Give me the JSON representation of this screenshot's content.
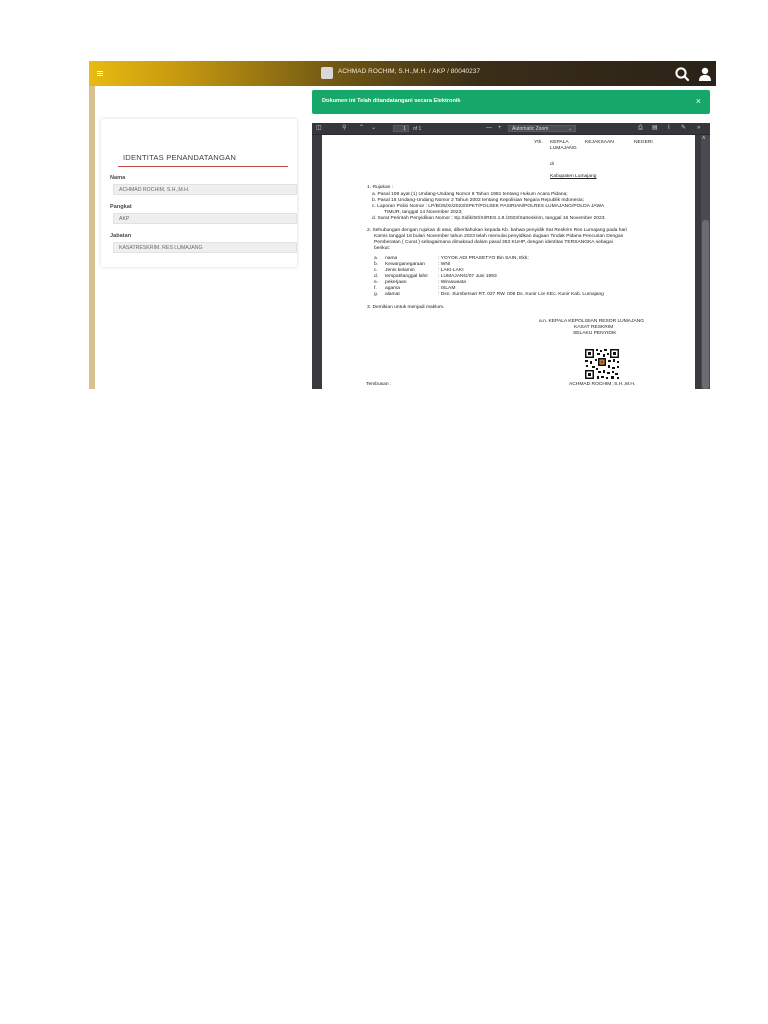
{
  "topbar": {
    "user_info": "ACHMAD ROCHIM, S.H.,M.H. / AKP / 80040237"
  },
  "identity_card": {
    "title": "IDENTITAS PENANDATANGAN",
    "fields": [
      {
        "label": "Nama",
        "value": "ACHMAD ROCHIM, S.H.,M.H."
      },
      {
        "label": "Pangkat",
        "value": "AKP"
      },
      {
        "label": "Jabatan",
        "value": "KASATRESKRIM. RES LUMAJANG"
      }
    ]
  },
  "alert": {
    "message": "Dokumen ini Telah ditandatangani secara Elektronik",
    "close": "×"
  },
  "pdf_viewer": {
    "page_input": "1",
    "page_total": "of 1",
    "zoom": "Automatic Zoom"
  },
  "document": {
    "recipient_yth": "Yth.",
    "recipient_1": "KEPALA",
    "recipient_2": "KEJAKSAAN",
    "recipient_3": "NEGERI",
    "recipient_4": "LUMAJANG",
    "recipient_di": "di",
    "recipient_place": "Kabupaten Lumajang",
    "s1_head": "1.  Rujukan :",
    "s1_a": "a.    Pasal 109 ayat (1) Undang-Undang Nomor 8 Tahun 1981 tentang Hukum Acara Pidana;",
    "s1_b": "b.    Pasal 16 Undang-Undang Nomor 2 Tahun 2002 tentang Kepolisian Negara Republik Indonesia;",
    "s1_c1": "c.    Laporan  Polisi  Nomor  :  LP/B/25/XI/2023/SPKT/POLSEK  PASIRIAN/POLRES  LUMAJANG/POLDA  JAWA",
    "s1_c2": "TIMUR, tanggal 14 November 2023;",
    "s1_d": "d.    Surat Perintah Penyidikan Nomor : Sp.Sidik/50/XI/RES.1.8./2023/Satreskrim, tanggal 16 November 2023.",
    "s2_1": "2.  Sehubungan dengan rujukan di atas, diberitahukan kepada Kb. bahwa penyidik Sat Reskrim Res Lumajang pada hari",
    "s2_2": "Kamis tanggal 16 bulan November tahun 2023 telah memulai penyidikan dugaan Tindak Pidana Pencurian Dengan",
    "s2_3": "Pemberatan ( Curat ) sebagaimana dimaksud dalam pasal 363 KUHP, dengan identitas TERSANGKA sebagai",
    "s2_4": "berikut:",
    "idents": [
      {
        "k": "a.",
        "label": "nama",
        "value": ": YOYOK ADI PRASETYO Bin SAIN, Ekk;"
      },
      {
        "k": "b.",
        "label": "Kewarganegaraan",
        "value": ": WNI"
      },
      {
        "k": "c.",
        "label": "Jenis kelamin",
        "value": ": LAKI-LAKI"
      },
      {
        "k": "d.",
        "label": "tempat/tanggal lahir",
        "value": ": LUMAJANG/07 Juni 1993"
      },
      {
        "k": "e.",
        "label": "pekerjaan",
        "value": ": Wiraswasta"
      },
      {
        "k": "f.",
        "label": "agama",
        "value": ": ISLAM"
      },
      {
        "k": "g.",
        "label": "alamat",
        "value": ": Dsn. Sumbersari RT. 027 RW. 006 Ds. Kunir Lor KEc. Kunir Kab. Lumajang"
      }
    ],
    "s3": "3.  Demikian untuk menjadi maklum.",
    "sig_1": "a.n. KEPALA KEPOLISIAN RESOR LUMAJANG",
    "sig_2": "KASAT RESKRIM",
    "sig_3": "SELAKU PENYIDIK",
    "sig_name": "ACHMAD ROCHIM, S.H.,M.H.",
    "tembusan": "Tembusan :"
  }
}
